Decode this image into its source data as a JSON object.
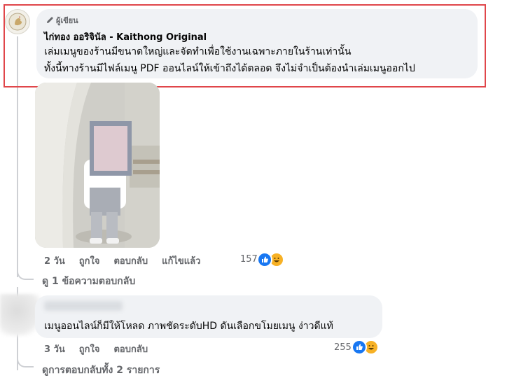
{
  "comment1": {
    "badge": "ผู้เขียน",
    "author": "ไก่ทอง ออริจินัล - Kaithong Original",
    "lines": [
      "เล่มเมนูของร้านมีขนาดใหญ่และจัดทำเพื่อใช้งานเฉพาะภายในร้านเท่านั้น",
      "ทั้งนี้ทางร้านมีไฟล์เมนู PDF ออนไลน์ให้เข้าถึงได้ตลอด จึงไม่จำเป็นต้องนำเล่มเมนูออกไป"
    ],
    "actions": {
      "time": "2 วัน",
      "like": "ถูกใจ",
      "reply": "ตอบกลับ",
      "edited": "แก้ไขแล้ว"
    },
    "reaction_count": "157"
  },
  "view_replies": "ดู 1 ข้อความตอบกลับ",
  "comment2": {
    "text": "เมนูออนไลน์ก็มีให้โหลด ภาพชัดระดับHD ดันเลือกขโมยเมนู ง่าวดีแท้",
    "actions": {
      "time": "3 วัน",
      "like": "ถูกใจ",
      "reply": "ตอบกลับ"
    },
    "reaction_count": "255"
  },
  "more_replies": "ดูการตอบกลับทั้ง 2 รายการ",
  "colors": {
    "bubble": "#f0f2f5",
    "highlight": "#e0464a",
    "like": "#1877f2",
    "haha": "#f7b125",
    "muted": "#65676b"
  }
}
